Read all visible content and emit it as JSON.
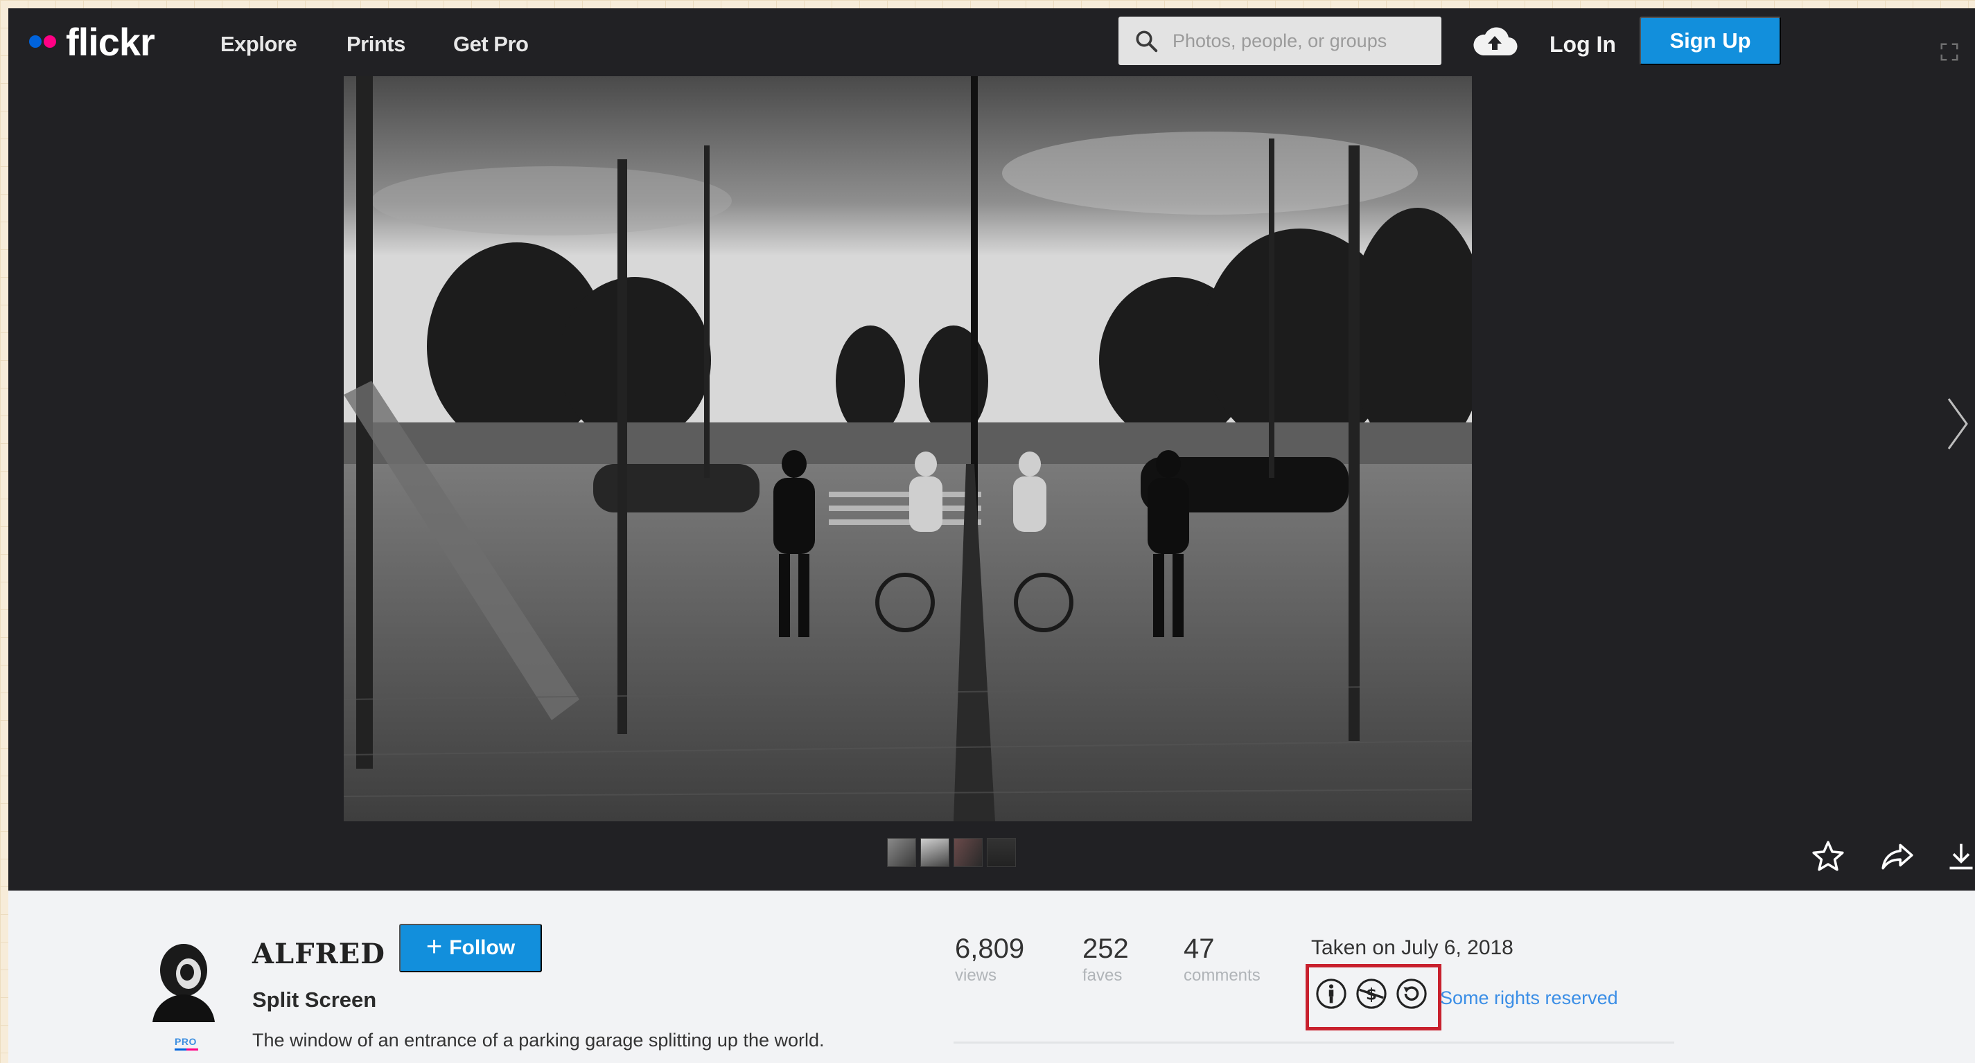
{
  "header": {
    "logo_text": "flickr",
    "nav": [
      {
        "label": "Explore"
      },
      {
        "label": "Prints"
      },
      {
        "label": "Get Pro"
      }
    ],
    "search_placeholder": "Photos, people, or groups",
    "login_label": "Log In",
    "signup_label": "Sign Up"
  },
  "photo": {
    "thumbnail_count": 4
  },
  "owner": {
    "name": "ALFRED",
    "badge": "PRO",
    "follow_label": "Follow"
  },
  "photo_info": {
    "title": "Split Screen",
    "description": "The window of an entrance of a parking garage splitting up the world."
  },
  "stats": [
    {
      "value": "6,809",
      "label": "views"
    },
    {
      "value": "252",
      "label": "faves"
    },
    {
      "value": "47",
      "label": "comments"
    }
  ],
  "meta": {
    "taken": "Taken on July 6, 2018",
    "license_text": "Some rights reserved",
    "license_icons": [
      "cc-by-icon",
      "cc-noncommercial-icon",
      "cc-sharealike-icon"
    ]
  },
  "colors": {
    "dark_bg": "#212124",
    "accent_blue": "#128fdc",
    "highlight_red": "#c8202d",
    "info_bg": "#f2f3f5"
  }
}
